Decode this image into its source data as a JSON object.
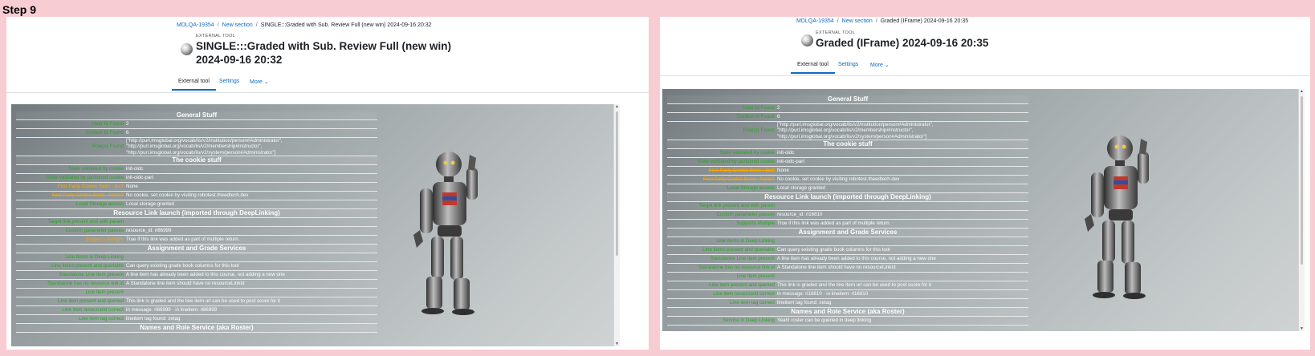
{
  "step_label": "Step 9",
  "left": {
    "breadcrumb": [
      "MDLQA-19354",
      "New section",
      "SINGLE:::Graded with Sub. Review Full (new win) 2024-09-16 20:32"
    ],
    "kicker": "EXTERNAL TOOL",
    "title_line1": "SINGLE:::Graded with Sub. Review Full (new win)",
    "title_line2": "2024-09-16 20:32",
    "tabs": [
      "External tool",
      "Settings",
      "More"
    ],
    "rows": [
      {
        "type": "header",
        "text": "General Stuff"
      },
      {
        "type": "row",
        "status": "ok",
        "key": "User Id Found",
        "value": "2"
      },
      {
        "type": "row",
        "status": "ok",
        "key": "Context Id Found",
        "value": "6"
      },
      {
        "type": "row",
        "status": "ok",
        "key": "Role(s) Found",
        "value": [
          "[\"http://purl.imsglobal.org/vocab/lis/v2/institution/person#Administrator\",",
          "\"http://purl.imsglobal.org/vocab/lis/v2/membership#Instructor\",",
          "\"http://purl.imsglobal.org/vocab/lis/v2/system/person#Administrator\"]"
        ]
      },
      {
        "type": "header",
        "text": "The cookie stuff"
      },
      {
        "type": "row",
        "status": "ok",
        "key": "State validated by cookie",
        "value": "init-oidc"
      },
      {
        "type": "row",
        "status": "ok",
        "key": "State validated by partioned cookie",
        "value": "init-oidc-part"
      },
      {
        "type": "row",
        "status": "warn",
        "key": "First Party Cookie Seen - lax?",
        "value": "None"
      },
      {
        "type": "row",
        "status": "warn-strike",
        "key": "First Party Cookie Seen - None?",
        "value": "No cookie, set cookie by visiting robotest.theedtech.dev"
      },
      {
        "type": "row",
        "status": "ok",
        "key": "Local Storage access",
        "value": "Local storage granted"
      },
      {
        "type": "header",
        "text": "Resource Link launch (imported through DeepLinking)"
      },
      {
        "type": "row",
        "status": "ok",
        "key": "Target link present and with param",
        "value": ""
      },
      {
        "type": "row",
        "status": "ok",
        "key": "Custom parameter passes",
        "value": "resource_id: rl86999"
      },
      {
        "type": "row",
        "status": "warn",
        "key": "Supports Multiple",
        "value": "True if this link was added as part of multiple return."
      },
      {
        "type": "header",
        "text": "Assignment and Grade Services"
      },
      {
        "type": "row",
        "status": "ok",
        "key": "Line items in Deep Linking",
        "value": ""
      },
      {
        "type": "row",
        "status": "ok",
        "key": "Line items present and queriable",
        "value": "Can query existing grade book columns for this tool"
      },
      {
        "type": "row",
        "status": "ok",
        "key": "Standalone Line item present",
        "value": "A line item has already been added to this course, not adding a new one"
      },
      {
        "type": "row",
        "status": "ok",
        "key": "Standalone has no resource link id",
        "value": "A Standalone line item should have no resourceLinkId"
      },
      {
        "type": "row",
        "status": "ok",
        "key": "Line item present",
        "value": ""
      },
      {
        "type": "row",
        "status": "ok",
        "key": "Line item present and queried",
        "value": "This link is graded and the line item url can be used to post score for it"
      },
      {
        "type": "row",
        "status": "ok",
        "key": "Line item resourceId correct",
        "value": "in message: rl86999 - in lineitem: rl86999"
      },
      {
        "type": "row",
        "status": "ok",
        "key": "Line item tag correct",
        "value": "lineitem tag found: zetag"
      },
      {
        "type": "header",
        "text": "Names and Role Service (aka Roster)"
      }
    ]
  },
  "right": {
    "breadcrumb": [
      "MDLQA-19354",
      "New section",
      "Graded (IFrame) 2024-09-16 20:35"
    ],
    "kicker": "EXTERNAL TOOL",
    "title_line1": "Graded (IFrame) 2024-09-16 20:35",
    "tabs": [
      "External tool",
      "Settings",
      "More"
    ],
    "rows": [
      {
        "type": "header",
        "text": "General Stuff"
      },
      {
        "type": "row",
        "status": "ok",
        "key": "User Id Found",
        "value": "2"
      },
      {
        "type": "row",
        "status": "ok",
        "key": "Context Id Found",
        "value": "6"
      },
      {
        "type": "row",
        "status": "ok",
        "key": "Role(s) Found",
        "value": [
          "[\"http://purl.imsglobal.org/vocab/lis/v2/institution/person#Administrator\",",
          "\"http://purl.imsglobal.org/vocab/lis/v2/membership#Instructor\",",
          "\"http://purl.imsglobal.org/vocab/lis/v2/system/person#Administrator\"]"
        ]
      },
      {
        "type": "header",
        "text": "The cookie stuff"
      },
      {
        "type": "row",
        "status": "ok",
        "key": "State validated by cookie",
        "value": "init-oidc"
      },
      {
        "type": "row",
        "status": "ok",
        "key": "State validated by partioned cookie",
        "value": "init-oidc-part"
      },
      {
        "type": "row",
        "status": "warn-strike",
        "key": "First Party Cookie Seen - lax?",
        "value": "None"
      },
      {
        "type": "row",
        "status": "warn-strike",
        "key": "First Party Cookie Seen - None?",
        "value": "No cookie, set cookie by visiting robotest.theedtech.dev"
      },
      {
        "type": "row",
        "status": "ok",
        "key": "Local Storage access",
        "value": "Local storage granted"
      },
      {
        "type": "header",
        "text": "Resource Link launch (imported through DeepLinking)"
      },
      {
        "type": "row",
        "status": "ok",
        "key": "Target link present and with param",
        "value": ""
      },
      {
        "type": "row",
        "status": "ok",
        "key": "Custom parameter passes",
        "value": "resource_id: rl16810"
      },
      {
        "type": "row",
        "status": "ok",
        "key": "Supports Multiple",
        "value": "True if this link was added as part of multiple return."
      },
      {
        "type": "header",
        "text": "Assignment and Grade Services"
      },
      {
        "type": "row",
        "status": "ok",
        "key": "Line items in Deep Linking",
        "value": ""
      },
      {
        "type": "row",
        "status": "ok",
        "key": "Line items present and queriable",
        "value": "Can query existing grade book columns for this tool"
      },
      {
        "type": "row",
        "status": "ok",
        "key": "Standalone Line item present",
        "value": "A line item has already been added to this course, not adding a new one"
      },
      {
        "type": "row",
        "status": "ok",
        "key": "Standalone has no resource link id",
        "value": "A Standalone line item should have no resourceLinkId"
      },
      {
        "type": "row",
        "status": "ok",
        "key": "Line item present",
        "value": ""
      },
      {
        "type": "row",
        "status": "ok",
        "key": "Line item present and queried",
        "value": "This link is graded and the line item url can be used to post score for it"
      },
      {
        "type": "row",
        "status": "ok",
        "key": "Line item resourceId correct",
        "value": "in message: rl16810 - in lineitem: rl16810"
      },
      {
        "type": "row",
        "status": "ok",
        "key": "Line item tag correct",
        "value": "lineitem tag found: zetag"
      },
      {
        "type": "header",
        "text": "Names and Role Service (aka Roster)"
      },
      {
        "type": "row",
        "status": "ok",
        "key": "Service in Deep Linking",
        "value": "Yeah! roster can be queried in deep linking"
      }
    ]
  },
  "colors": {
    "ok": "#2ea328",
    "warn": "#ffa600",
    "link": "#0f6cbf"
  }
}
